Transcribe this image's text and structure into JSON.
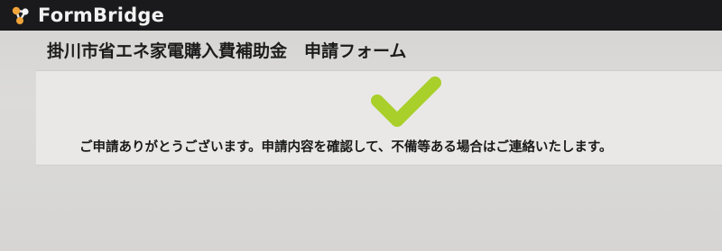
{
  "app": {
    "brand": "FormBridge",
    "logo_icon": "formbridge-logo-icon"
  },
  "form": {
    "title": "掛川市省エネ家電購入費補助金　申請フォーム"
  },
  "confirmation": {
    "icon": "checkmark-icon",
    "icon_color": "#a9cf2a",
    "message": "ご申請ありがとうございます。申請内容を確認して、不備等ある場合はご連絡いたします。"
  },
  "colors": {
    "app_bar": "#1a1a1c",
    "background": "#d9d8d6",
    "card": "#e9e8e6",
    "accent": "#a9cf2a"
  }
}
